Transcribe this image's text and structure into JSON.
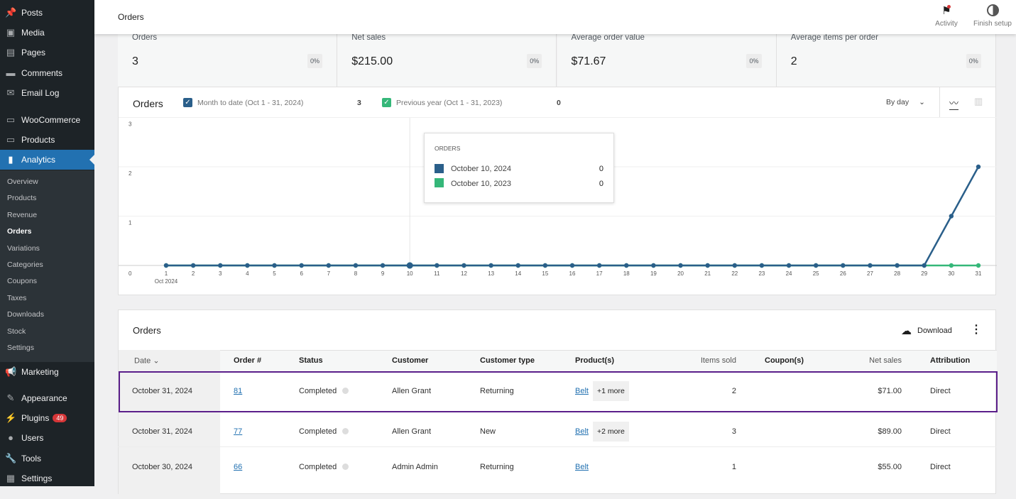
{
  "sidebar": {
    "items": [
      {
        "label": "Posts",
        "icon": "pin-icon"
      },
      {
        "label": "Media",
        "icon": "media-icon"
      },
      {
        "label": "Pages",
        "icon": "pages-icon"
      },
      {
        "label": "Comments",
        "icon": "comment-icon"
      },
      {
        "label": "Email Log",
        "icon": "mail-icon"
      },
      {
        "label": "WooCommerce",
        "icon": "woo-icon"
      },
      {
        "label": "Products",
        "icon": "box-icon"
      },
      {
        "label": "Analytics",
        "icon": "bar-chart-icon"
      },
      {
        "label": "Marketing",
        "icon": "megaphone-icon"
      },
      {
        "label": "Appearance",
        "icon": "brush-icon"
      },
      {
        "label": "Plugins",
        "icon": "plug-icon",
        "badge": "49"
      },
      {
        "label": "Users",
        "icon": "user-icon"
      },
      {
        "label": "Tools",
        "icon": "wrench-icon"
      },
      {
        "label": "Settings",
        "icon": "settings-icon"
      }
    ],
    "submenu": [
      "Overview",
      "Products",
      "Revenue",
      "Orders",
      "Variations",
      "Categories",
      "Coupons",
      "Taxes",
      "Downloads",
      "Stock",
      "Settings"
    ],
    "current_sub": "Orders"
  },
  "header": {
    "title": "Orders",
    "activity": "Activity",
    "finish_setup": "Finish setup"
  },
  "stats": [
    {
      "label": "Orders",
      "value": "3",
      "change": "0%"
    },
    {
      "label": "Net sales",
      "value": "$215.00",
      "change": "0%"
    },
    {
      "label": "Average order value",
      "value": "$71.67",
      "change": "0%"
    },
    {
      "label": "Average items per order",
      "value": "2",
      "change": "0%"
    }
  ],
  "chart_panel": {
    "title": "Orders",
    "legend": [
      {
        "label": "Month to date (Oct 1 - 31, 2024)",
        "total": "3",
        "color": "#2a5f8a"
      },
      {
        "label": "Previous year (Oct 1 - 31, 2023)",
        "total": "0",
        "color": "#35b779"
      }
    ],
    "interval": "By day",
    "tooltip": {
      "title": "ORDERS",
      "rows": [
        {
          "label": "October 10, 2024",
          "value": "0"
        },
        {
          "label": "October 10, 2023",
          "value": "0"
        }
      ]
    }
  },
  "chart_data": {
    "type": "line",
    "x": [
      1,
      2,
      3,
      4,
      5,
      6,
      7,
      8,
      9,
      10,
      11,
      12,
      13,
      14,
      15,
      16,
      17,
      18,
      19,
      20,
      21,
      22,
      23,
      24,
      25,
      26,
      27,
      28,
      29,
      30,
      31
    ],
    "x_sublabel": "Oct 2024",
    "yticks": [
      "0",
      "1",
      "2",
      "3"
    ],
    "ylim": [
      0,
      3
    ],
    "series": [
      {
        "name": "Month to date (Oct 1 - 31, 2024)",
        "color": "#2a5f8a",
        "values": [
          0,
          0,
          0,
          0,
          0,
          0,
          0,
          0,
          0,
          0,
          0,
          0,
          0,
          0,
          0,
          0,
          0,
          0,
          0,
          0,
          0,
          0,
          0,
          0,
          0,
          0,
          0,
          0,
          0,
          1,
          2
        ]
      },
      {
        "name": "Previous year (Oct 1 - 31, 2023)",
        "color": "#35b779",
        "values": [
          0,
          0,
          0,
          0,
          0,
          0,
          0,
          0,
          0,
          0,
          0,
          0,
          0,
          0,
          0,
          0,
          0,
          0,
          0,
          0,
          0,
          0,
          0,
          0,
          0,
          0,
          0,
          0,
          0,
          0,
          0
        ]
      }
    ],
    "highlight_x": 10,
    "grid": true
  },
  "table": {
    "title": "Orders",
    "download": "Download",
    "headers": [
      "Date",
      "Order #",
      "Status",
      "Customer",
      "Customer type",
      "Product(s)",
      "Items sold",
      "Coupon(s)",
      "Net sales",
      "Attribution"
    ],
    "rows": [
      {
        "date": "October 31, 2024",
        "order": "81",
        "status": "Completed",
        "customer": "Allen Grant",
        "type": "Returning",
        "product": "Belt",
        "more": "+1 more",
        "items": "2",
        "coupons": "",
        "net": "$71.00",
        "attr": "Direct"
      },
      {
        "date": "October 31, 2024",
        "order": "77",
        "status": "Completed",
        "customer": "Allen Grant",
        "type": "New",
        "product": "Belt",
        "more": "+2 more",
        "items": "3",
        "coupons": "",
        "net": "$89.00",
        "attr": "Direct"
      },
      {
        "date": "October 30, 2024",
        "order": "66",
        "status": "Completed",
        "customer": "Admin Admin",
        "type": "Returning",
        "product": "Belt",
        "more": "",
        "items": "1",
        "coupons": "",
        "net": "$55.00",
        "attr": "Direct"
      }
    ]
  }
}
